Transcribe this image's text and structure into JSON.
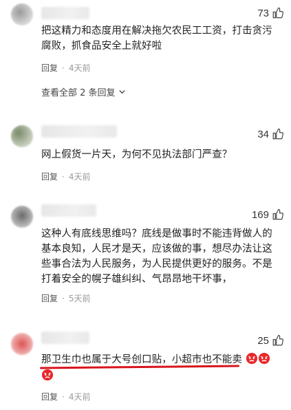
{
  "comments": [
    {
      "likes": "73",
      "text": "把这精力和态度用在解决拖欠农民工工资，打击贪污腐败，抓食品安全上就好啦",
      "reply_label": "回复",
      "time": "4天前",
      "view_all": "查看全部 2 条回复"
    },
    {
      "likes": "34",
      "text": "网上假货一片天，为何不见执法部门严查？",
      "reply_label": "回复",
      "time": "4天前"
    },
    {
      "likes": "169",
      "text": "这种人有底线思维吗？底线是做事时不能违背做人的基本良知，人民才是天，应该做的事，想尽办法让这些事合法为人民服务，为人民提供更好的服务。不是打着安全的幌子雄纠纠、气昂昂地干坏事，",
      "reply_label": "回复",
      "time": "5天前"
    },
    {
      "likes": "25",
      "text": "那卫生巾也属于大号创口贴，小超市也不能卖",
      "emoji": "angry-face-icon",
      "reply_label": "回复",
      "time": "4天前"
    }
  ],
  "colors": {
    "highlight_underline": "#d8141c",
    "emoji_red": "#e8282b",
    "meta_gray": "#999999"
  }
}
